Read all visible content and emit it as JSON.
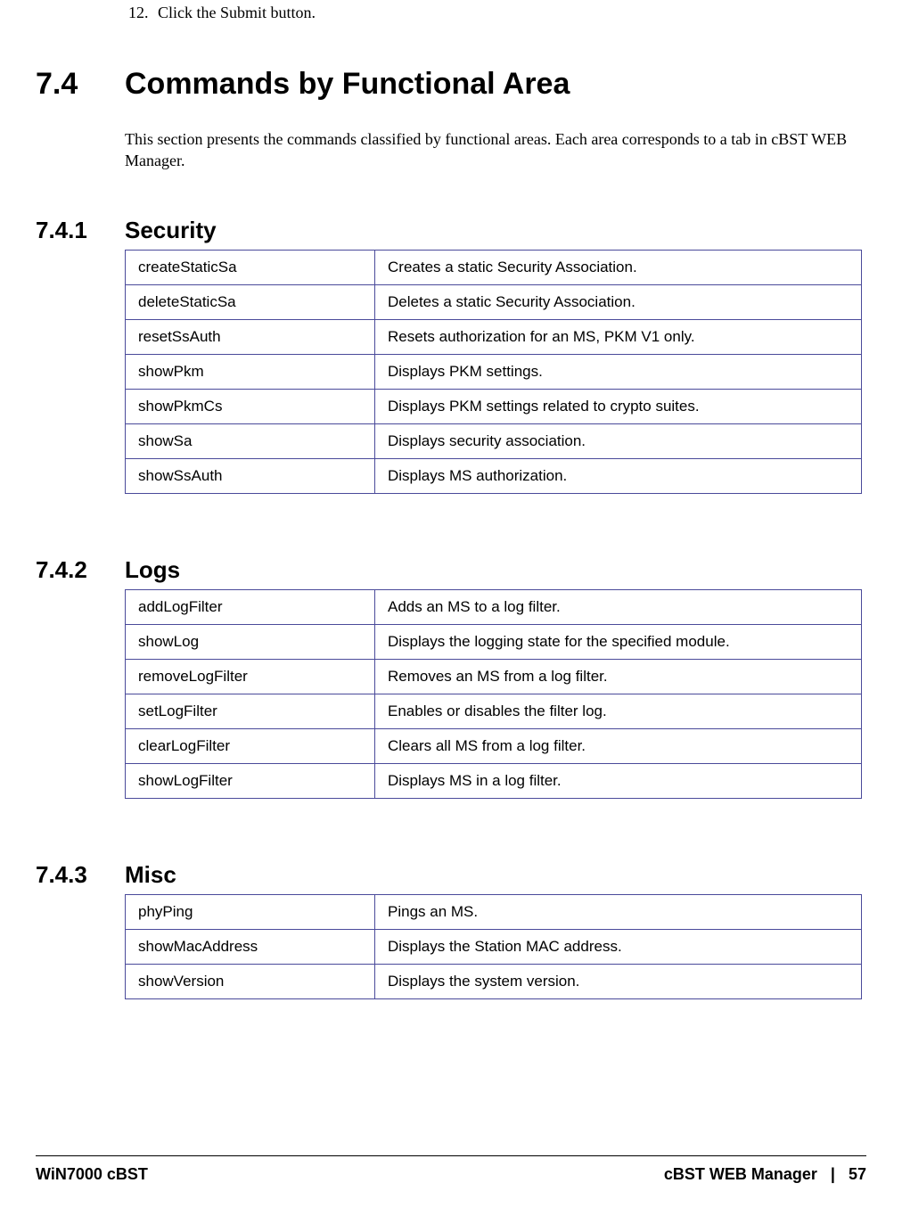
{
  "step": {
    "number": "12.",
    "text": "Click the Submit button."
  },
  "section": {
    "number": "7.4",
    "title": "Commands by Functional Area",
    "intro": "This section presents the commands classified by functional areas. Each area corresponds to a tab in cBST WEB Manager."
  },
  "subsections": [
    {
      "number": "7.4.1",
      "title": "Security",
      "rows": [
        {
          "cmd": "createStaticSa",
          "desc": "Creates a static Security Association."
        },
        {
          "cmd": "deleteStaticSa",
          "desc": "Deletes a static Security Association."
        },
        {
          "cmd": "resetSsAuth",
          "desc": "Resets authorization for an MS, PKM V1 only."
        },
        {
          "cmd": "showPkm",
          "desc": "Displays PKM settings."
        },
        {
          "cmd": "showPkmCs",
          "desc": "Displays PKM settings related to crypto suites."
        },
        {
          "cmd": "showSa",
          "desc": "Displays security association."
        },
        {
          "cmd": "showSsAuth",
          "desc": "Displays MS authorization."
        }
      ]
    },
    {
      "number": "7.4.2",
      "title": "Logs",
      "rows": [
        {
          "cmd": "addLogFilter",
          "desc": "Adds an MS to a log filter."
        },
        {
          "cmd": "showLog",
          "desc": "Displays the logging state for the specified module."
        },
        {
          "cmd": "removeLogFilter",
          "desc": "Removes an MS from a log filter."
        },
        {
          "cmd": "setLogFilter",
          "desc": "Enables or disables the filter log."
        },
        {
          "cmd": "clearLogFilter",
          "desc": "Clears all MS from a log filter."
        },
        {
          "cmd": "showLogFilter",
          "desc": "Displays MS in a log filter."
        }
      ]
    },
    {
      "number": "7.4.3",
      "title": "Misc",
      "rows": [
        {
          "cmd": "phyPing",
          "desc": "Pings an MS."
        },
        {
          "cmd": "showMacAddress",
          "desc": "Displays the Station MAC address."
        },
        {
          "cmd": "showVersion",
          "desc": "Displays the system version."
        }
      ]
    }
  ],
  "footer": {
    "left": "WiN7000 cBST",
    "right_label": "cBST WEB Manager",
    "sep": "|",
    "page": "57"
  }
}
